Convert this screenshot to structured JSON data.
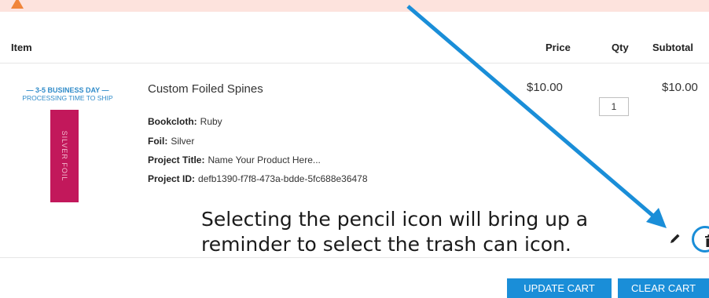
{
  "table": {
    "headers": {
      "item": "Item",
      "price": "Price",
      "qty": "Qty",
      "subtotal": "Subtotal"
    }
  },
  "cart_item": {
    "thumbnail": {
      "line1": "— 3-5 BUSINESS DAY —",
      "line2": "PROCESSING TIME TO SHIP",
      "spine_text": "SILVER FOIL",
      "spine_color": "#c2185b"
    },
    "name": "Custom Foiled Spines",
    "options": [
      {
        "label": "Bookcloth:",
        "value": "Ruby"
      },
      {
        "label": "Foil:",
        "value": "Silver"
      },
      {
        "label": "Project Title:",
        "value": "Name Your Product Here..."
      },
      {
        "label": "Project ID:",
        "value": "defb1390-f7f8-473a-bdde-5fc688e36478"
      }
    ],
    "price": "$10.00",
    "qty": "1",
    "subtotal": "$10.00"
  },
  "annotation": {
    "text": "Selecting the pencil icon will bring up a reminder to select the trash can icon.",
    "color": "#1a8ed8"
  },
  "actions": {
    "edit_icon": "pencil-icon",
    "remove_icon": "trash-icon",
    "update_cart": "UPDATE CART",
    "clear_cart": "CLEAR CART"
  },
  "colors": {
    "accent": "#1a8ed8",
    "alert_bg": "#fde3dd",
    "alert_icon": "#f0853a"
  }
}
